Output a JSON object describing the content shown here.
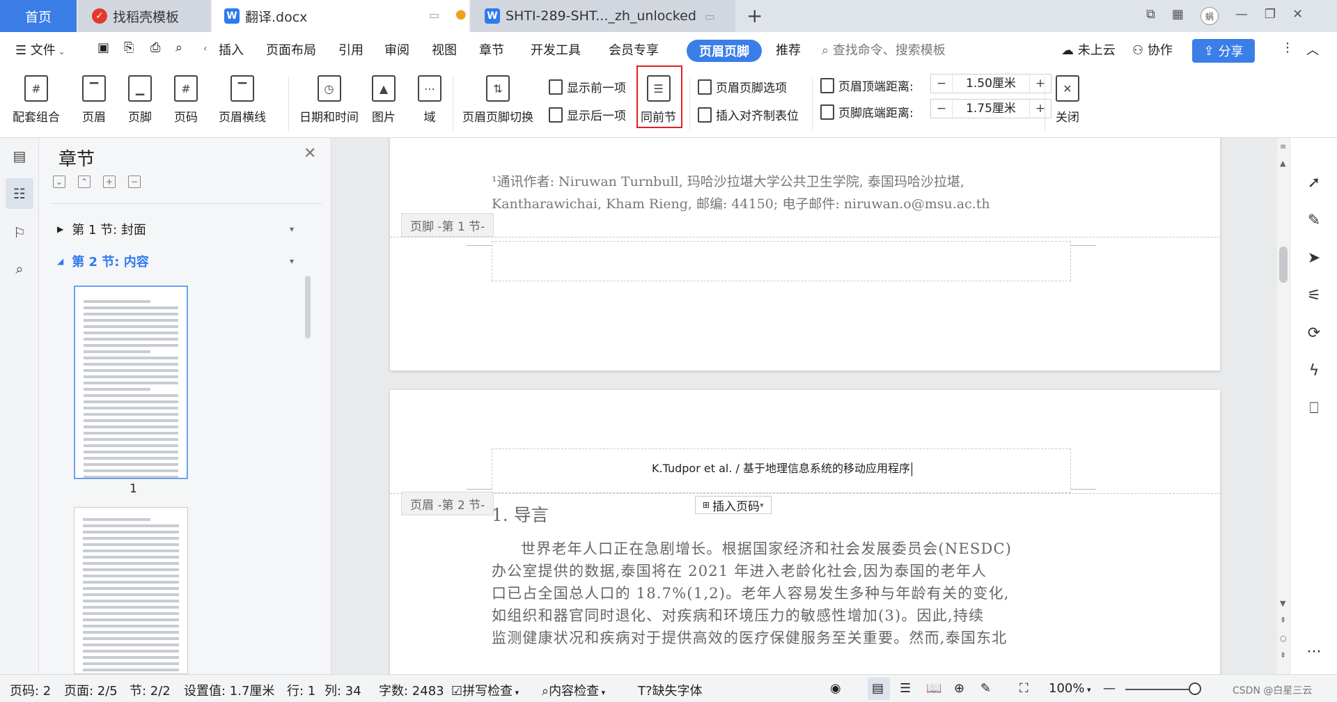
{
  "tabs": {
    "home": "首页",
    "template": "找稻壳模板",
    "doc1": "翻译.docx",
    "doc2": "SHTI-289-SHT..._zh_unlocked",
    "user_badge": "蜗"
  },
  "menu": {
    "file": "文件",
    "items": [
      "插入",
      "页面布局",
      "引用",
      "审阅",
      "视图",
      "章节",
      "开发工具",
      "会员专享"
    ],
    "active": "页眉页脚",
    "recommend": "推荐",
    "search_placeholder": "查找命令、搜索模板",
    "cloud": "未上云",
    "collab": "协作",
    "share": "分享"
  },
  "ribbon": {
    "config": "配套组合",
    "header": "页眉",
    "footer": "页脚",
    "pagenum": "页码",
    "header_line": "页眉横线",
    "datetime": "日期和时间",
    "picture": "图片",
    "field": "域",
    "switch": "页眉页脚切换",
    "show_prev": "显示前一项",
    "show_next": "显示后一项",
    "same_prev": "同前节",
    "hf_options": "页眉页脚选项",
    "align_tab": "插入对齐制表位",
    "header_dist_label": "页眉顶端距离:",
    "header_dist": "1.50厘米",
    "footer_dist_label": "页脚底端距离:",
    "footer_dist": "1.75厘米",
    "close": "关闭"
  },
  "panel": {
    "title": "章节",
    "sections": [
      "第 1 节: 封面",
      "第 2 节: 内容"
    ],
    "page1_label": "1"
  },
  "doc": {
    "footnote_line1": "¹通讯作者: Niruwan Turnbull, 玛哈沙拉堪大学公共卫生学院, 泰国玛哈沙拉堪,",
    "footnote_line2": "Kantharawichai, Kham Rieng, 邮编: 44150; 电子邮件: niruwan.o@msu.ac.th",
    "footer_label": "页脚 -第 1 节-",
    "header_label": "页眉 -第 2 节-",
    "header_text": "K.Tudpor et al. /  基于地理信息系统的移动应用程序",
    "insert_pagenum": "插入页码",
    "heading": "1. 导言",
    "body": [
      "世界老年人口正在急剧增长。根据国家经济和社会发展委员会(NESDC)",
      "办公室提供的数据,泰国将在 2021 年进入老龄化社会,因为泰国的老年人",
      "口已占全国总人口的 18.7%(1,2)。老年人容易发生多种与年龄有关的变化,",
      "如组织和器官同时退化、对疾病和环境压力的敏感性增加(3)。因此,持续",
      "监测健康状况和疾病对于提供高效的医疗保健服务至关重要。然而,泰国东北"
    ]
  },
  "status": {
    "page": "页码: 2",
    "pages": "页面: 2/5",
    "section": "节: 2/2",
    "setting": "设置值: 1.7厘米",
    "row": "行: 1",
    "col": "列: 34",
    "words": "字数: 2483",
    "spell": "拼写检查",
    "content_check": "内容检查",
    "missing_font": "缺失字体",
    "zoom": "100%",
    "watermark": "CSDN @白星三云"
  }
}
